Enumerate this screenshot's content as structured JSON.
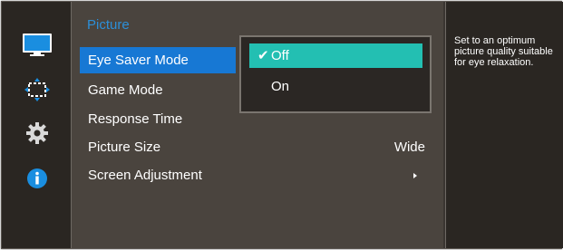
{
  "sidebar": {
    "icons": [
      {
        "name": "picture-icon",
        "selected": true
      },
      {
        "name": "onscreen-display-icon",
        "selected": false
      },
      {
        "name": "system-icon",
        "selected": false
      },
      {
        "name": "information-icon",
        "selected": false
      }
    ]
  },
  "menu": {
    "category": "Picture",
    "items": [
      {
        "label": "Eye Saver Mode",
        "value": "",
        "selected": true
      },
      {
        "label": "Game Mode",
        "value": ""
      },
      {
        "label": "Response Time",
        "value": ""
      },
      {
        "label": "Picture Size",
        "value": "Wide"
      },
      {
        "label": "Screen Adjustment",
        "value": "",
        "submenu": true
      }
    ]
  },
  "popup": {
    "options": [
      {
        "label": "Off",
        "selected": true
      },
      {
        "label": "On",
        "selected": false
      }
    ]
  },
  "help": {
    "text": "Set to an optimum picture quality suitable for eye relaxation."
  },
  "colors": {
    "selection_blue": "#1778d4",
    "option_teal": "#23bfb2",
    "category_title": "#2c8fd8"
  }
}
